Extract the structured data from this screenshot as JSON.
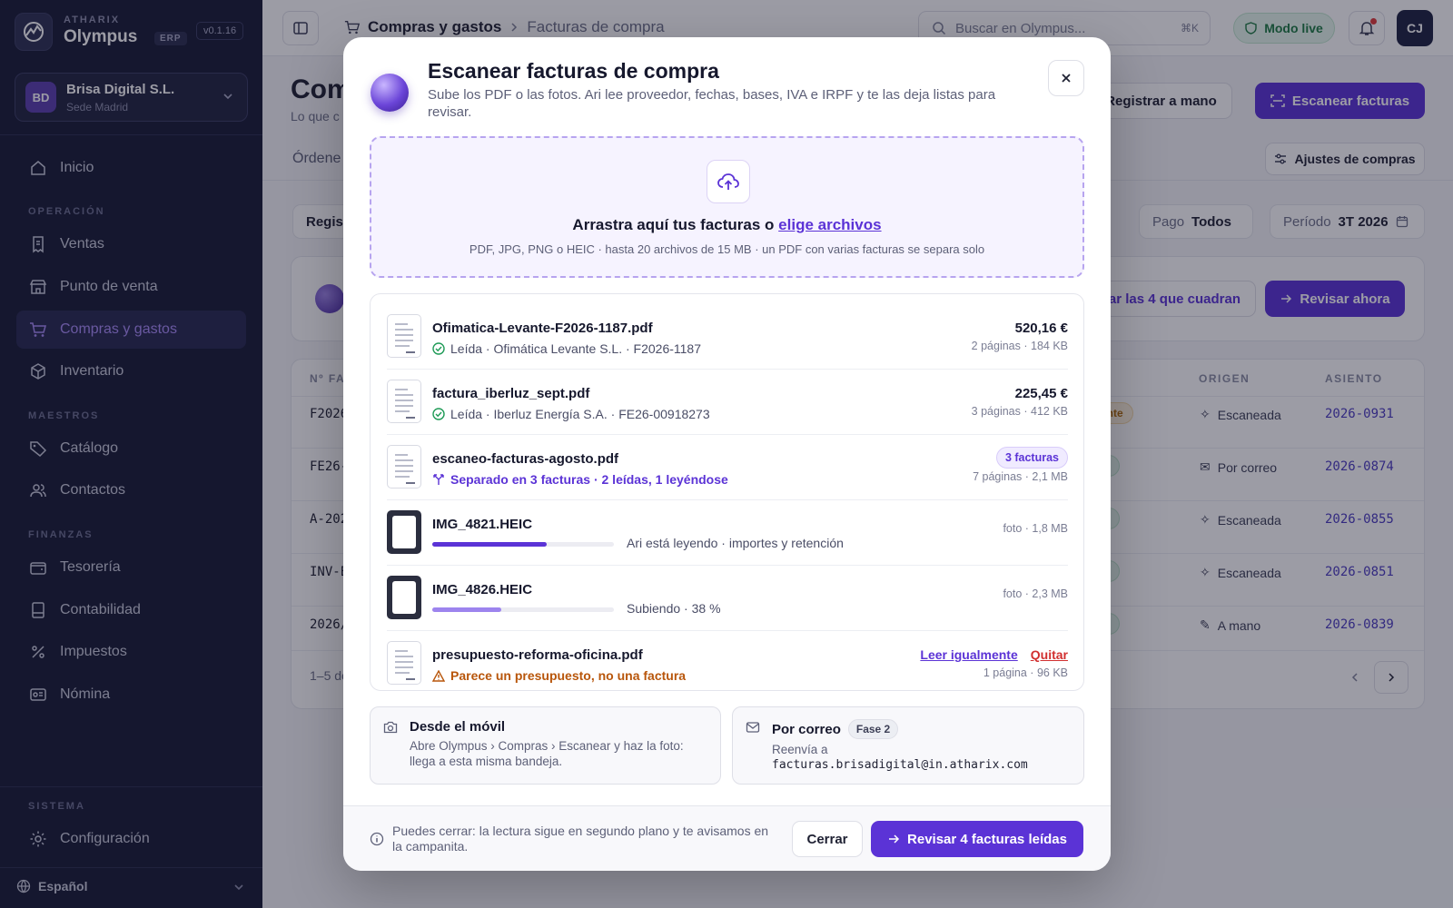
{
  "brand": {
    "company_top": "ATHARIX",
    "name": "Olympus",
    "erp": "ERP",
    "version": "v0.1.16"
  },
  "company": {
    "initials": "BD",
    "name": "Brisa Digital S.L.",
    "branch": "Sede Madrid"
  },
  "sidebar": {
    "sections": {
      "operacion": "OPERACIÓN",
      "maestros": "MAESTROS",
      "finanzas": "FINANZAS",
      "sistema": "SISTEMA"
    },
    "items": {
      "inicio": "Inicio",
      "ventas": "Ventas",
      "pos": "Punto de venta",
      "compras": "Compras y gastos",
      "inventario": "Inventario",
      "catalogo": "Catálogo",
      "contactos": "Contactos",
      "tesoreria": "Tesorería",
      "contabilidad": "Contabilidad",
      "impuestos": "Impuestos",
      "nomina": "Nómina",
      "configuracion": "Configuración"
    },
    "language": "Español"
  },
  "topbar": {
    "breadcrumb_1": "Compras y gastos",
    "breadcrumb_2": "Facturas de compra",
    "search_placeholder": "Buscar en Olympus...",
    "search_kbd": "⌘K",
    "mode": "Modo live",
    "user_initials": "CJ"
  },
  "page": {
    "title": "Comp",
    "subtitle": "Lo que c",
    "btn_manual": "Registrar a mano",
    "btn_scan": "Escanear facturas",
    "tab_partial": "Órdene",
    "btn_ajustes": "Ajustes de compras",
    "filter_reg": "Regis",
    "filter_pago_label": "Pago",
    "filter_pago_value": "Todos",
    "filter_periodo_label": "Período",
    "filter_periodo_value": "3T 2026",
    "banner_btn_cuadran": "ar las 4 que cuadran",
    "banner_btn_revisar": "Revisar ahora"
  },
  "table": {
    "headers": {
      "num": "Nº FA",
      "estado": "O",
      "origen": "ORIGEN",
      "asiento": "ASIENTO"
    },
    "rows": [
      {
        "num": "F2026",
        "estado": "ndiente",
        "origen": "Escaneada",
        "asiento": "2026-0931"
      },
      {
        "num": "FE26-",
        "estado": "gada",
        "origen": "Por correo",
        "asiento": "2026-0874"
      },
      {
        "num": "A-202",
        "estado": "gada",
        "origen": "Escaneada",
        "asiento": "2026-0855"
      },
      {
        "num": "INV-E",
        "estado": "gada",
        "origen": "Escaneada",
        "asiento": "2026-0851"
      },
      {
        "num": "2026/",
        "estado": "gada",
        "origen": "A mano",
        "asiento": "2026-0839"
      }
    ],
    "pagination": "1–5 de"
  },
  "modal": {
    "title": "Escanear facturas de compra",
    "subtitle": "Sube los PDF o las fotos. Ari lee proveedor, fechas, bases, IVA e IRPF y te las deja listas para revisar.",
    "drop_main": "Arrastra aquí tus facturas o ",
    "drop_link": "elige archivos",
    "drop_hint": "PDF, JPG, PNG o HEIC · hasta 20 archivos de 15 MB · un PDF con varias facturas se separa solo",
    "files": [
      {
        "name": "Ofimatica-Levante-F2026-1187.pdf",
        "status": "Leída · Ofimática Levante S.L. · F2026-1187",
        "amount": "520,16 €",
        "meta": "2 páginas · 184 KB"
      },
      {
        "name": "factura_iberluz_sept.pdf",
        "status": "Leída · Iberluz Energía S.A. · FE26-00918273",
        "amount": "225,45 €",
        "meta": "3 páginas · 412 KB"
      },
      {
        "name": "escaneo-facturas-agosto.pdf",
        "status": "Separado en 3 facturas · 2 leídas, 1 leyéndose",
        "badge": "3 facturas",
        "meta": "7 páginas · 2,1 MB"
      },
      {
        "name": "IMG_4821.HEIC",
        "status": "Ari está leyendo · importes y retención",
        "meta": "foto · 1,8 MB",
        "progress": 0.63
      },
      {
        "name": "IMG_4826.HEIC",
        "status": "Subiendo · 38 %",
        "meta": "foto · 2,3 MB",
        "progress": 0.38
      },
      {
        "name": "presupuesto-reforma-oficina.pdf",
        "status": "Parece un presupuesto, no una factura",
        "action_read": "Leer igualmente",
        "action_remove": "Quitar",
        "meta": "1 página · 96 KB"
      }
    ],
    "mobile_title": "Desde el móvil",
    "mobile_text": "Abre Olympus › Compras › Escanear y haz la foto: llega a esta misma bandeja.",
    "mail_title": "Por correo",
    "mail_phase": "Fase 2",
    "mail_text": "Reenvía a",
    "mail_address": "facturas.brisadigital@in.atharix.com",
    "footer_text": "Puedes cerrar: la lectura sigue en segundo plano y te avisamos en la campanita.",
    "btn_close": "Cerrar",
    "btn_review": "Revisar 4 facturas leídas"
  },
  "colors": {
    "accent": "#5b33d6",
    "sidebar": "#181a35",
    "success": "#1d7a43",
    "warning": "#b8560b",
    "danger": "#d12f2f"
  }
}
